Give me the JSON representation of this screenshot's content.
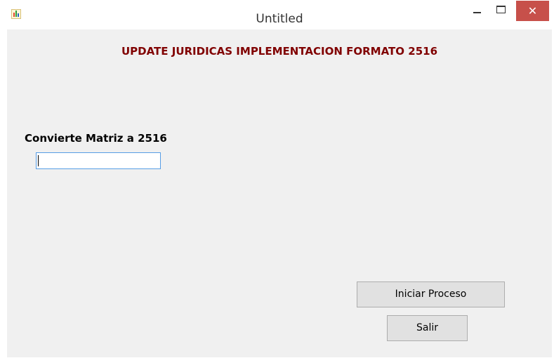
{
  "window": {
    "title": "Untitled",
    "close_glyph": "✕",
    "app_icon": "chart-app-icon"
  },
  "form": {
    "heading": "UPDATE JURIDICAS IMPLEMENTACION FORMATO 2516",
    "field_label": "Convierte Matriz a 2516",
    "field_value": ""
  },
  "buttons": {
    "start_label": "Iniciar Proceso",
    "exit_label": "Salir"
  },
  "colors": {
    "heading": "#800000",
    "close_button": "#c7504a",
    "input_border": "#569de5"
  }
}
